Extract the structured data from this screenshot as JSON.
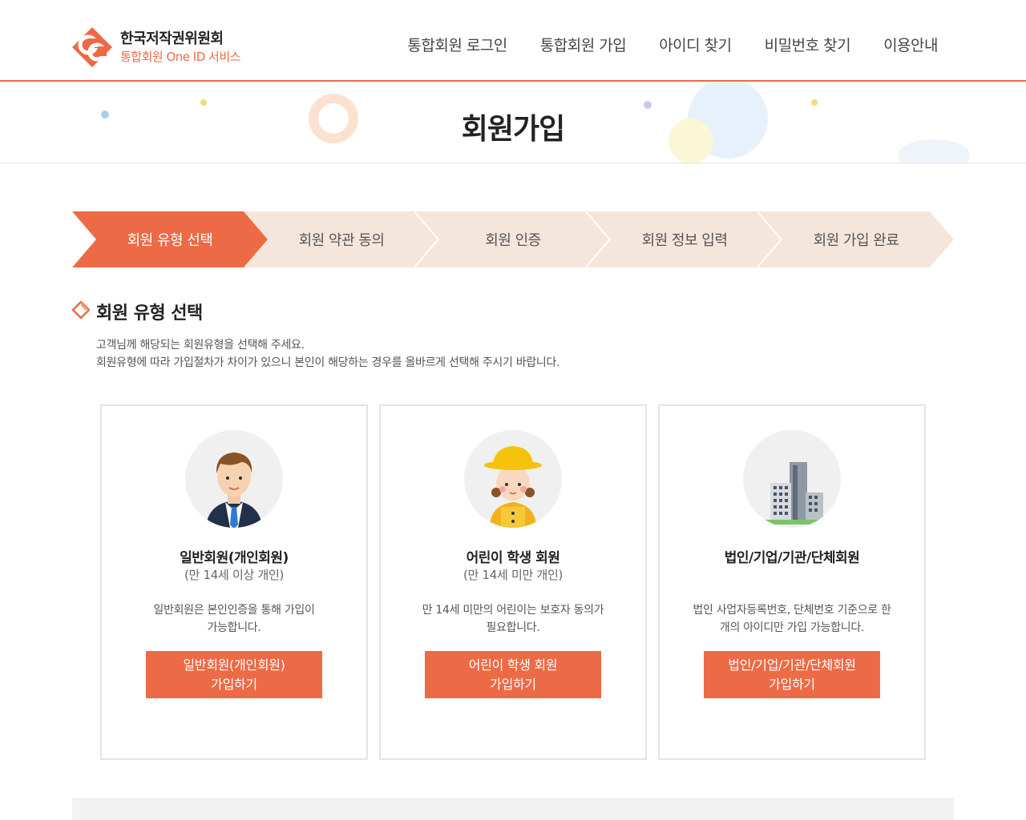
{
  "brand": {
    "title": "한국저작권위원회",
    "subtitle": "통합회원 One ID 서비스",
    "accent_color": "#ec6a45"
  },
  "nav": {
    "items": [
      {
        "label": "통합회원 로그인"
      },
      {
        "label": "통합회원 가입"
      },
      {
        "label": "아이디 찾기"
      },
      {
        "label": "비밀번호 찾기"
      },
      {
        "label": "이용안내"
      }
    ]
  },
  "page": {
    "title": "회원가입"
  },
  "steps": [
    {
      "label": "회원 유형 선택",
      "active": true
    },
    {
      "label": "회원 약관 동의",
      "active": false
    },
    {
      "label": "회원 인증",
      "active": false
    },
    {
      "label": "회원 정보 입력",
      "active": false
    },
    {
      "label": "회원 가입 완료",
      "active": false
    }
  ],
  "section": {
    "title": "회원 유형 선택",
    "desc_line1": "고객님께 해당되는 회원유형을 선택해 주세요.",
    "desc_line2": "회원유형에 따라 가입절차가 차이가 있으니 본인이 해당하는 경우를 올바르게 선택해 주시기 바랍니다."
  },
  "cards": [
    {
      "icon": "businessman-icon",
      "title": "일반회원(개인회원)",
      "subtitle": "(만 14세 이상 개인)",
      "desc_line1": "일반회원은 본인인증을 통해 가입이",
      "desc_line2": "가능합니다.",
      "button_line1": "일반회원(개인회원)",
      "button_line2": "가입하기"
    },
    {
      "icon": "child-student-icon",
      "title": "어린이 학생 회원",
      "subtitle": "(만 14세 미만 개인)",
      "desc_line1": "만 14세 미만의 어린이는 보호자 동의가",
      "desc_line2": "필요합니다.",
      "button_line1": "어린이 학생 회원",
      "button_line2": "가입하기"
    },
    {
      "icon": "building-icon",
      "title": "법인/기업/기관/단체회원",
      "subtitle": "",
      "desc_line1": "법인 사업자등록번호, 단체번호 기준으로 한",
      "desc_line2": "개의 아이디만 가입 가능합니다.",
      "button_line1": "법인/기업/기관/단체회원",
      "button_line2": "가입하기"
    }
  ]
}
